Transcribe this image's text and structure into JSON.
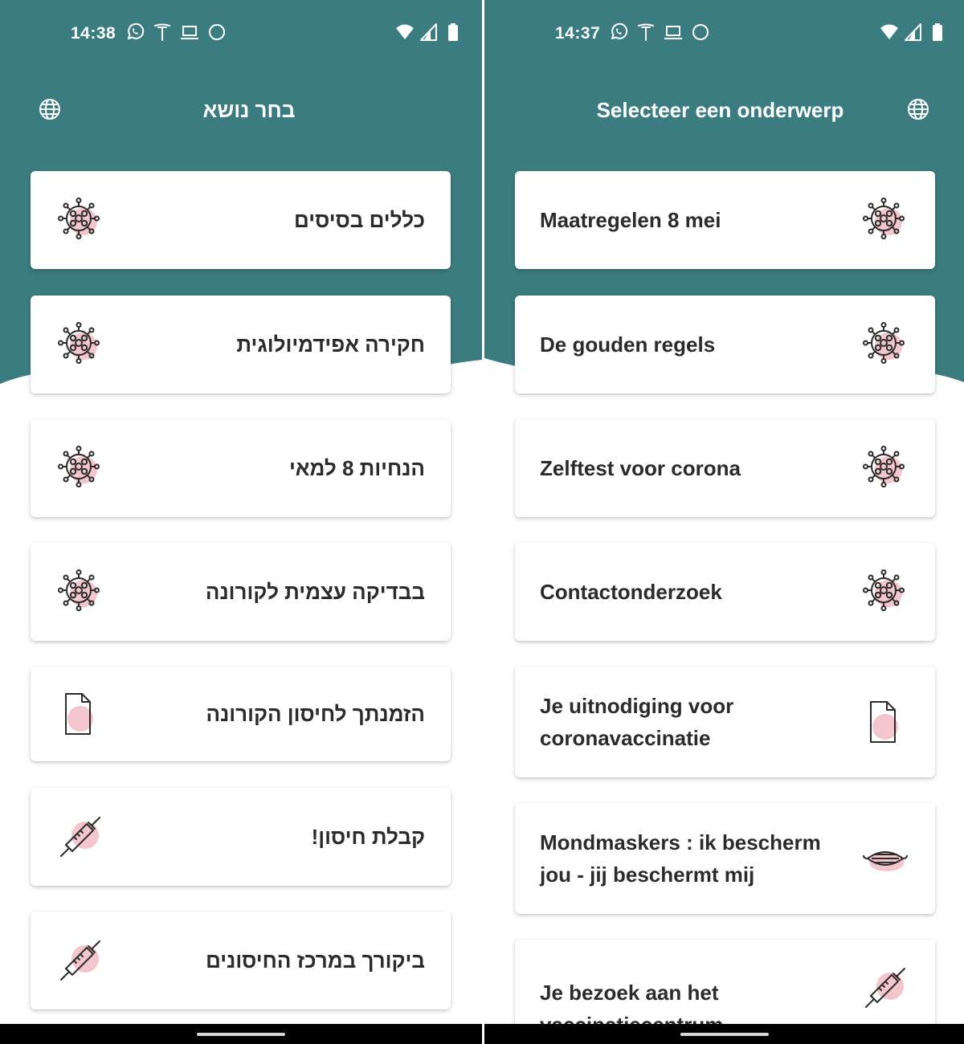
{
  "colors": {
    "teal": "#3b7c80",
    "pink": "#f2c6cc",
    "icon_stroke": "#2b2b2b",
    "text": "#2b2b2b"
  },
  "left": {
    "status": {
      "time": "14:38",
      "icons_left": [
        "whatsapp-icon",
        "antenna-icon",
        "laptop-icon",
        "circle-icon"
      ],
      "icons_right": [
        "wifi-icon",
        "signal-icon",
        "battery-icon"
      ]
    },
    "header": {
      "title": "בחר נושא",
      "icon": "globe-icon"
    },
    "cards": [
      {
        "label": "כללים בסיסים",
        "icon": "virus-icon"
      },
      {
        "label": "חקירה אפידמיולוגית",
        "icon": "virus-icon"
      },
      {
        "label": "הנחיות 8 למאי",
        "icon": "virus-icon"
      },
      {
        "label": "בבדיקה עצמית לקורונה",
        "icon": "virus-icon"
      },
      {
        "label": "הזמנתך לחיסון הקורונה",
        "icon": "document-icon"
      },
      {
        "label": "קבלת חיסון!",
        "icon": "syringe-icon"
      },
      {
        "label": "ביקורך במרכז החיסונים",
        "icon": "syringe-icon"
      }
    ]
  },
  "right": {
    "status": {
      "time": "14:37",
      "icons_left": [
        "whatsapp-icon",
        "antenna-icon",
        "laptop-icon",
        "circle-icon"
      ],
      "icons_right": [
        "wifi-icon",
        "signal-icon",
        "battery-icon"
      ]
    },
    "header": {
      "title": "Selecteer een onderwerp",
      "icon": "globe-icon"
    },
    "cards": [
      {
        "label": "Maatregelen 8 mei",
        "icon": "virus-icon"
      },
      {
        "label": "De gouden regels",
        "icon": "virus-icon"
      },
      {
        "label": "Zelftest voor corona",
        "icon": "virus-icon"
      },
      {
        "label": "Contactonderzoek",
        "icon": "virus-icon"
      },
      {
        "label": "Je uitnodiging voor coronavaccinatie",
        "icon": "document-icon"
      },
      {
        "label": "Mondmaskers : ik bescherm jou - jij beschermt mij",
        "icon": "mask-icon"
      },
      {
        "label": "Je bezoek aan het vaccinatiecentrum",
        "icon": "syringe-icon"
      }
    ]
  }
}
